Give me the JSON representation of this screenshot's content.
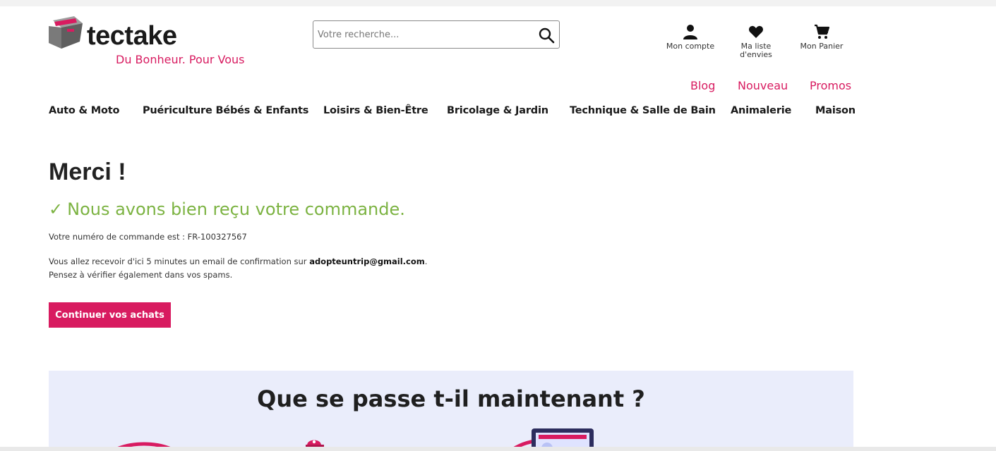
{
  "header": {
    "brand": "tectake",
    "tagline": "Du Bonheur. Pour Vous",
    "search_placeholder": "Votre recherche...",
    "account_label": "Mon compte",
    "wishlist_label": "Ma liste d'envies",
    "cart_label": "Mon Panier",
    "top_links": {
      "blog": "Blog",
      "nouveau": "Nouveau",
      "promos": "Promos"
    },
    "brand_color": "#d81b60"
  },
  "nav": {
    "items": [
      "Auto & Moto",
      "Puériculture Bébés & Enfants",
      "Loisirs & Bien-Être",
      "Bricolage & Jardin",
      "Technique & Salle de Bain",
      "Animalerie",
      "Maison"
    ]
  },
  "main": {
    "title": "Merci !",
    "confirmation_check": "✓",
    "confirmation": "Nous avons bien reçu votre commande.",
    "order_prefix": "Votre numéro de commande est : ",
    "order_number": "FR-100327567",
    "email_prefix": "Vous allez recevoir d'ici 5 minutes un email de confirmation sur ",
    "email": "adopteuntrip@gmail.com",
    "email_suffix": ".",
    "spam_note": "Pensez à vérifier également dans vos spams.",
    "continue_button": "Continuer vos achats",
    "success_color": "#7cb342"
  },
  "panel": {
    "title": "Que se passe t-il maintenant ?",
    "background": "#eaedfb"
  },
  "icons": {
    "search": "search-icon",
    "account": "user-icon",
    "wishlist": "heart-icon",
    "cart": "cart-icon"
  }
}
